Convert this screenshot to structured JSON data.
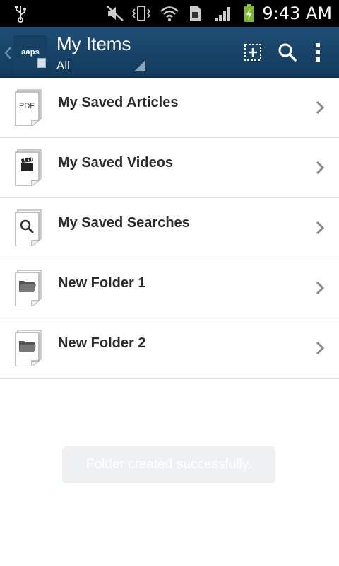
{
  "status_bar": {
    "time": "9:43 AM",
    "icons": [
      "usb-icon",
      "mute-icon",
      "vibrate-icon",
      "wifi-icon",
      "sim-icon",
      "signal-icon",
      "battery-charging-icon"
    ]
  },
  "action_bar": {
    "logo_text": "aaps",
    "title": "My Items",
    "subtitle": "All",
    "buttons": [
      "add-folder-icon",
      "search-icon",
      "overflow-menu-icon"
    ],
    "background": "#1a4468"
  },
  "list": {
    "items": [
      {
        "label": "My Saved Articles",
        "icon": "pdf-icon",
        "icon_text": "PDF"
      },
      {
        "label": "My Saved Videos",
        "icon": "video-clapper-icon"
      },
      {
        "label": "My Saved Searches",
        "icon": "search-icon"
      },
      {
        "label": "New Folder 1",
        "icon": "folder-icon"
      },
      {
        "label": "New Folder 2",
        "icon": "folder-icon"
      }
    ]
  },
  "toast": {
    "message": "Folder created successfully."
  }
}
